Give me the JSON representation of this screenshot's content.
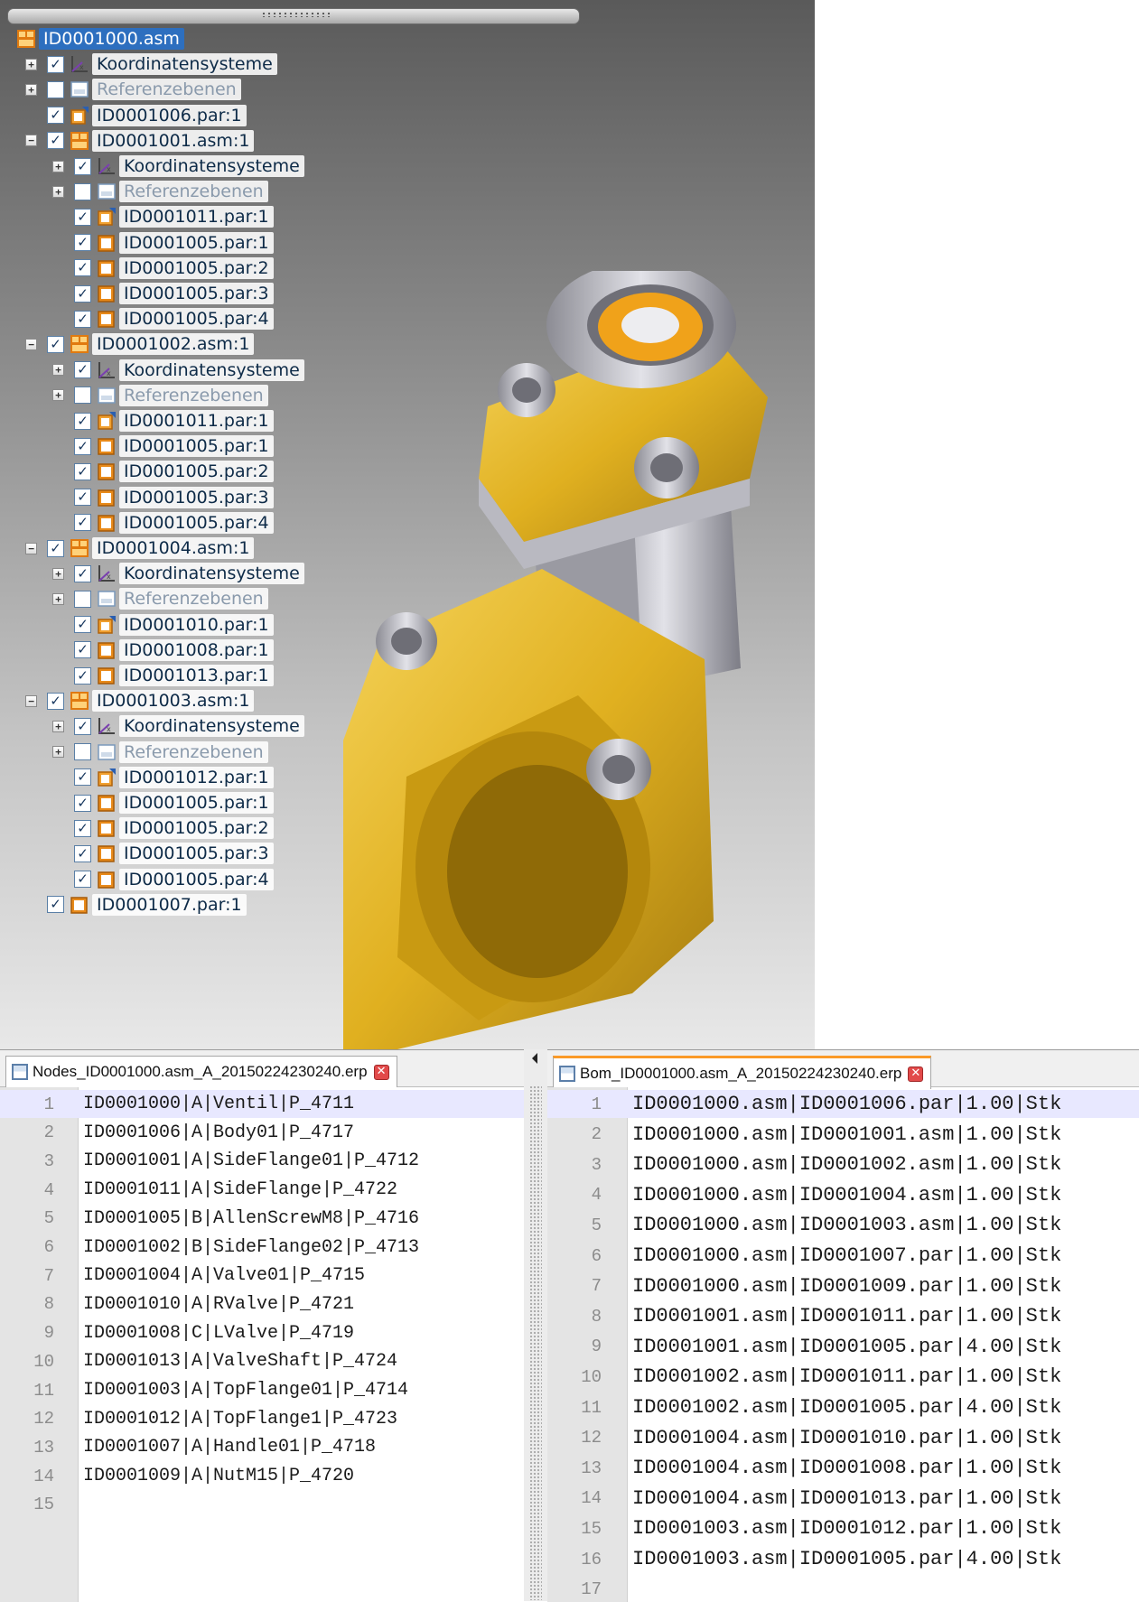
{
  "tree": {
    "rows": [
      {
        "label": "ID0001000.asm",
        "icon": "assembly-icon",
        "expander": "",
        "checked": null,
        "disabled": false,
        "depth": 0,
        "root": true
      },
      {
        "label": "Koordinatensysteme",
        "icon": "coordinate-system-icon",
        "expander": "+",
        "checked": true,
        "disabled": false,
        "depth": 1
      },
      {
        "label": "Referenzebenen",
        "icon": "reference-plane-icon",
        "expander": "+",
        "checked": false,
        "disabled": true,
        "depth": 1
      },
      {
        "label": "ID0001006.par:1",
        "icon": "part-base-icon",
        "expander": "",
        "checked": true,
        "disabled": false,
        "depth": 1
      },
      {
        "label": "ID0001001.asm:1",
        "icon": "assembly-icon",
        "expander": "−",
        "checked": true,
        "disabled": false,
        "depth": 1
      },
      {
        "label": "Koordinatensysteme",
        "icon": "coordinate-system-icon",
        "expander": "+",
        "checked": true,
        "disabled": false,
        "depth": 2
      },
      {
        "label": "Referenzebenen",
        "icon": "reference-plane-icon",
        "expander": "+",
        "checked": false,
        "disabled": true,
        "depth": 2
      },
      {
        "label": "ID0001011.par:1",
        "icon": "part-base-icon",
        "expander": "",
        "checked": true,
        "disabled": false,
        "depth": 2
      },
      {
        "label": "ID0001005.par:1",
        "icon": "part-icon",
        "expander": "",
        "checked": true,
        "disabled": false,
        "depth": 2
      },
      {
        "label": "ID0001005.par:2",
        "icon": "part-icon",
        "expander": "",
        "checked": true,
        "disabled": false,
        "depth": 2
      },
      {
        "label": "ID0001005.par:3",
        "icon": "part-icon",
        "expander": "",
        "checked": true,
        "disabled": false,
        "depth": 2
      },
      {
        "label": "ID0001005.par:4",
        "icon": "part-icon",
        "expander": "",
        "checked": true,
        "disabled": false,
        "depth": 2
      },
      {
        "label": "ID0001002.asm:1",
        "icon": "assembly-icon",
        "expander": "−",
        "checked": true,
        "disabled": false,
        "depth": 1
      },
      {
        "label": "Koordinatensysteme",
        "icon": "coordinate-system-icon",
        "expander": "+",
        "checked": true,
        "disabled": false,
        "depth": 2
      },
      {
        "label": "Referenzebenen",
        "icon": "reference-plane-icon",
        "expander": "+",
        "checked": false,
        "disabled": true,
        "depth": 2
      },
      {
        "label": "ID0001011.par:1",
        "icon": "part-base-icon",
        "expander": "",
        "checked": true,
        "disabled": false,
        "depth": 2
      },
      {
        "label": "ID0001005.par:1",
        "icon": "part-icon",
        "expander": "",
        "checked": true,
        "disabled": false,
        "depth": 2
      },
      {
        "label": "ID0001005.par:2",
        "icon": "part-icon",
        "expander": "",
        "checked": true,
        "disabled": false,
        "depth": 2
      },
      {
        "label": "ID0001005.par:3",
        "icon": "part-icon",
        "expander": "",
        "checked": true,
        "disabled": false,
        "depth": 2
      },
      {
        "label": "ID0001005.par:4",
        "icon": "part-icon",
        "expander": "",
        "checked": true,
        "disabled": false,
        "depth": 2
      },
      {
        "label": "ID0001004.asm:1",
        "icon": "assembly-icon",
        "expander": "−",
        "checked": true,
        "disabled": false,
        "depth": 1
      },
      {
        "label": "Koordinatensysteme",
        "icon": "coordinate-system-icon",
        "expander": "+",
        "checked": true,
        "disabled": false,
        "depth": 2
      },
      {
        "label": "Referenzebenen",
        "icon": "reference-plane-icon",
        "expander": "+",
        "checked": false,
        "disabled": true,
        "depth": 2
      },
      {
        "label": "ID0001010.par:1",
        "icon": "part-base-icon",
        "expander": "",
        "checked": true,
        "disabled": false,
        "depth": 2
      },
      {
        "label": "ID0001008.par:1",
        "icon": "part-icon",
        "expander": "",
        "checked": true,
        "disabled": false,
        "depth": 2
      },
      {
        "label": "ID0001013.par:1",
        "icon": "part-icon",
        "expander": "",
        "checked": true,
        "disabled": false,
        "depth": 2
      },
      {
        "label": "ID0001003.asm:1",
        "icon": "assembly-icon",
        "expander": "−",
        "checked": true,
        "disabled": false,
        "depth": 1
      },
      {
        "label": "Koordinatensysteme",
        "icon": "coordinate-system-icon",
        "expander": "+",
        "checked": true,
        "disabled": false,
        "depth": 2
      },
      {
        "label": "Referenzebenen",
        "icon": "reference-plane-icon",
        "expander": "+",
        "checked": false,
        "disabled": true,
        "depth": 2
      },
      {
        "label": "ID0001012.par:1",
        "icon": "part-base-icon",
        "expander": "",
        "checked": true,
        "disabled": false,
        "depth": 2
      },
      {
        "label": "ID0001005.par:1",
        "icon": "part-icon",
        "expander": "",
        "checked": true,
        "disabled": false,
        "depth": 2
      },
      {
        "label": "ID0001005.par:2",
        "icon": "part-icon",
        "expander": "",
        "checked": true,
        "disabled": false,
        "depth": 2
      },
      {
        "label": "ID0001005.par:3",
        "icon": "part-icon",
        "expander": "",
        "checked": true,
        "disabled": false,
        "depth": 2
      },
      {
        "label": "ID0001005.par:4",
        "icon": "part-icon",
        "expander": "",
        "checked": true,
        "disabled": false,
        "depth": 2
      },
      {
        "label": "ID0001007.par:1",
        "icon": "part-icon",
        "expander": "",
        "checked": true,
        "disabled": false,
        "depth": 1
      }
    ]
  },
  "nodes_editor": {
    "tab_title": "Nodes_ID0001000.asm_A_20150224230240.erp",
    "tab_icon": "save-icon",
    "lines": [
      "ID0001000|A|Ventil|P_4711",
      "ID0001006|A|Body01|P_4717",
      "ID0001001|A|SideFlange01|P_4712",
      "ID0001011|A|SideFlange|P_4722",
      "ID0001005|B|AllenScrewM8|P_4716",
      "ID0001002|B|SideFlange02|P_4713",
      "ID0001004|A|Valve01|P_4715",
      "ID0001010|A|RValve|P_4721",
      "ID0001008|C|LValve|P_4719",
      "ID0001013|A|ValveShaft|P_4724",
      "ID0001003|A|TopFlange01|P_4714",
      "ID0001012|A|TopFlange1|P_4723",
      "ID0001007|A|Handle01|P_4718",
      "ID0001009|A|NutM15|P_4720",
      ""
    ]
  },
  "bom_editor": {
    "tab_title": "Bom_ID0001000.asm_A_20150224230240.erp",
    "tab_icon": "save-icon",
    "lines": [
      "ID0001000.asm|ID0001006.par|1.00|Stk",
      "ID0001000.asm|ID0001001.asm|1.00|Stk",
      "ID0001000.asm|ID0001002.asm|1.00|Stk",
      "ID0001000.asm|ID0001004.asm|1.00|Stk",
      "ID0001000.asm|ID0001003.asm|1.00|Stk",
      "ID0001000.asm|ID0001007.par|1.00|Stk",
      "ID0001000.asm|ID0001009.par|1.00|Stk",
      "ID0001001.asm|ID0001011.par|1.00|Stk",
      "ID0001001.asm|ID0001005.par|4.00|Stk",
      "ID0001002.asm|ID0001011.par|1.00|Stk",
      "ID0001002.asm|ID0001005.par|4.00|Stk",
      "ID0001004.asm|ID0001010.par|1.00|Stk",
      "ID0001004.asm|ID0001008.par|1.00|Stk",
      "ID0001004.asm|ID0001013.par|1.00|Stk",
      "ID0001003.asm|ID0001012.par|1.00|Stk",
      "ID0001003.asm|ID0001005.par|4.00|Stk",
      ""
    ]
  },
  "colors": {
    "model_gold": "#e0b020",
    "model_steel": "#b8b8c0",
    "selection_blue": "#2d6fbf",
    "tab_accent": "#fa9a28"
  }
}
